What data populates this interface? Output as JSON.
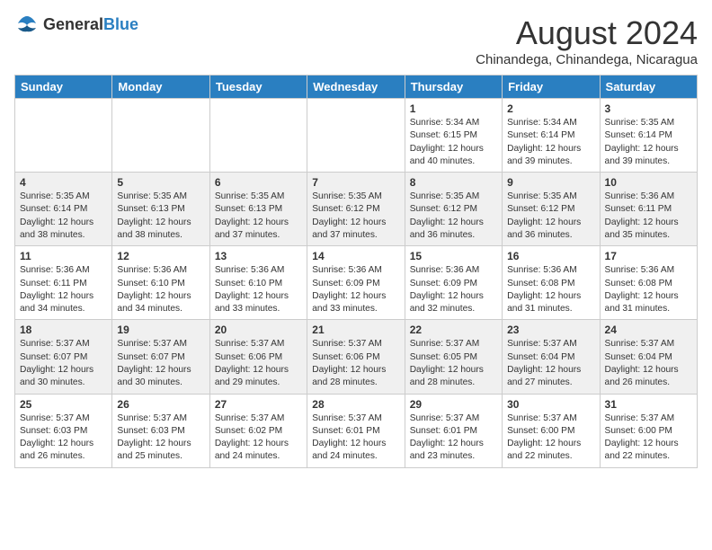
{
  "header": {
    "logo_general": "General",
    "logo_blue": "Blue",
    "month_title": "August 2024",
    "location": "Chinandega, Chinandega, Nicaragua"
  },
  "weekdays": [
    "Sunday",
    "Monday",
    "Tuesday",
    "Wednesday",
    "Thursday",
    "Friday",
    "Saturday"
  ],
  "weeks": [
    [
      {
        "day": "",
        "content": ""
      },
      {
        "day": "",
        "content": ""
      },
      {
        "day": "",
        "content": ""
      },
      {
        "day": "",
        "content": ""
      },
      {
        "day": "1",
        "content": "Sunrise: 5:34 AM\nSunset: 6:15 PM\nDaylight: 12 hours\nand 40 minutes."
      },
      {
        "day": "2",
        "content": "Sunrise: 5:34 AM\nSunset: 6:14 PM\nDaylight: 12 hours\nand 39 minutes."
      },
      {
        "day": "3",
        "content": "Sunrise: 5:35 AM\nSunset: 6:14 PM\nDaylight: 12 hours\nand 39 minutes."
      }
    ],
    [
      {
        "day": "4",
        "content": "Sunrise: 5:35 AM\nSunset: 6:14 PM\nDaylight: 12 hours\nand 38 minutes."
      },
      {
        "day": "5",
        "content": "Sunrise: 5:35 AM\nSunset: 6:13 PM\nDaylight: 12 hours\nand 38 minutes."
      },
      {
        "day": "6",
        "content": "Sunrise: 5:35 AM\nSunset: 6:13 PM\nDaylight: 12 hours\nand 37 minutes."
      },
      {
        "day": "7",
        "content": "Sunrise: 5:35 AM\nSunset: 6:12 PM\nDaylight: 12 hours\nand 37 minutes."
      },
      {
        "day": "8",
        "content": "Sunrise: 5:35 AM\nSunset: 6:12 PM\nDaylight: 12 hours\nand 36 minutes."
      },
      {
        "day": "9",
        "content": "Sunrise: 5:35 AM\nSunset: 6:12 PM\nDaylight: 12 hours\nand 36 minutes."
      },
      {
        "day": "10",
        "content": "Sunrise: 5:36 AM\nSunset: 6:11 PM\nDaylight: 12 hours\nand 35 minutes."
      }
    ],
    [
      {
        "day": "11",
        "content": "Sunrise: 5:36 AM\nSunset: 6:11 PM\nDaylight: 12 hours\nand 34 minutes."
      },
      {
        "day": "12",
        "content": "Sunrise: 5:36 AM\nSunset: 6:10 PM\nDaylight: 12 hours\nand 34 minutes."
      },
      {
        "day": "13",
        "content": "Sunrise: 5:36 AM\nSunset: 6:10 PM\nDaylight: 12 hours\nand 33 minutes."
      },
      {
        "day": "14",
        "content": "Sunrise: 5:36 AM\nSunset: 6:09 PM\nDaylight: 12 hours\nand 33 minutes."
      },
      {
        "day": "15",
        "content": "Sunrise: 5:36 AM\nSunset: 6:09 PM\nDaylight: 12 hours\nand 32 minutes."
      },
      {
        "day": "16",
        "content": "Sunrise: 5:36 AM\nSunset: 6:08 PM\nDaylight: 12 hours\nand 31 minutes."
      },
      {
        "day": "17",
        "content": "Sunrise: 5:36 AM\nSunset: 6:08 PM\nDaylight: 12 hours\nand 31 minutes."
      }
    ],
    [
      {
        "day": "18",
        "content": "Sunrise: 5:37 AM\nSunset: 6:07 PM\nDaylight: 12 hours\nand 30 minutes."
      },
      {
        "day": "19",
        "content": "Sunrise: 5:37 AM\nSunset: 6:07 PM\nDaylight: 12 hours\nand 30 minutes."
      },
      {
        "day": "20",
        "content": "Sunrise: 5:37 AM\nSunset: 6:06 PM\nDaylight: 12 hours\nand 29 minutes."
      },
      {
        "day": "21",
        "content": "Sunrise: 5:37 AM\nSunset: 6:06 PM\nDaylight: 12 hours\nand 28 minutes."
      },
      {
        "day": "22",
        "content": "Sunrise: 5:37 AM\nSunset: 6:05 PM\nDaylight: 12 hours\nand 28 minutes."
      },
      {
        "day": "23",
        "content": "Sunrise: 5:37 AM\nSunset: 6:04 PM\nDaylight: 12 hours\nand 27 minutes."
      },
      {
        "day": "24",
        "content": "Sunrise: 5:37 AM\nSunset: 6:04 PM\nDaylight: 12 hours\nand 26 minutes."
      }
    ],
    [
      {
        "day": "25",
        "content": "Sunrise: 5:37 AM\nSunset: 6:03 PM\nDaylight: 12 hours\nand 26 minutes."
      },
      {
        "day": "26",
        "content": "Sunrise: 5:37 AM\nSunset: 6:03 PM\nDaylight: 12 hours\nand 25 minutes."
      },
      {
        "day": "27",
        "content": "Sunrise: 5:37 AM\nSunset: 6:02 PM\nDaylight: 12 hours\nand 24 minutes."
      },
      {
        "day": "28",
        "content": "Sunrise: 5:37 AM\nSunset: 6:01 PM\nDaylight: 12 hours\nand 24 minutes."
      },
      {
        "day": "29",
        "content": "Sunrise: 5:37 AM\nSunset: 6:01 PM\nDaylight: 12 hours\nand 23 minutes."
      },
      {
        "day": "30",
        "content": "Sunrise: 5:37 AM\nSunset: 6:00 PM\nDaylight: 12 hours\nand 22 minutes."
      },
      {
        "day": "31",
        "content": "Sunrise: 5:37 AM\nSunset: 6:00 PM\nDaylight: 12 hours\nand 22 minutes."
      }
    ]
  ]
}
